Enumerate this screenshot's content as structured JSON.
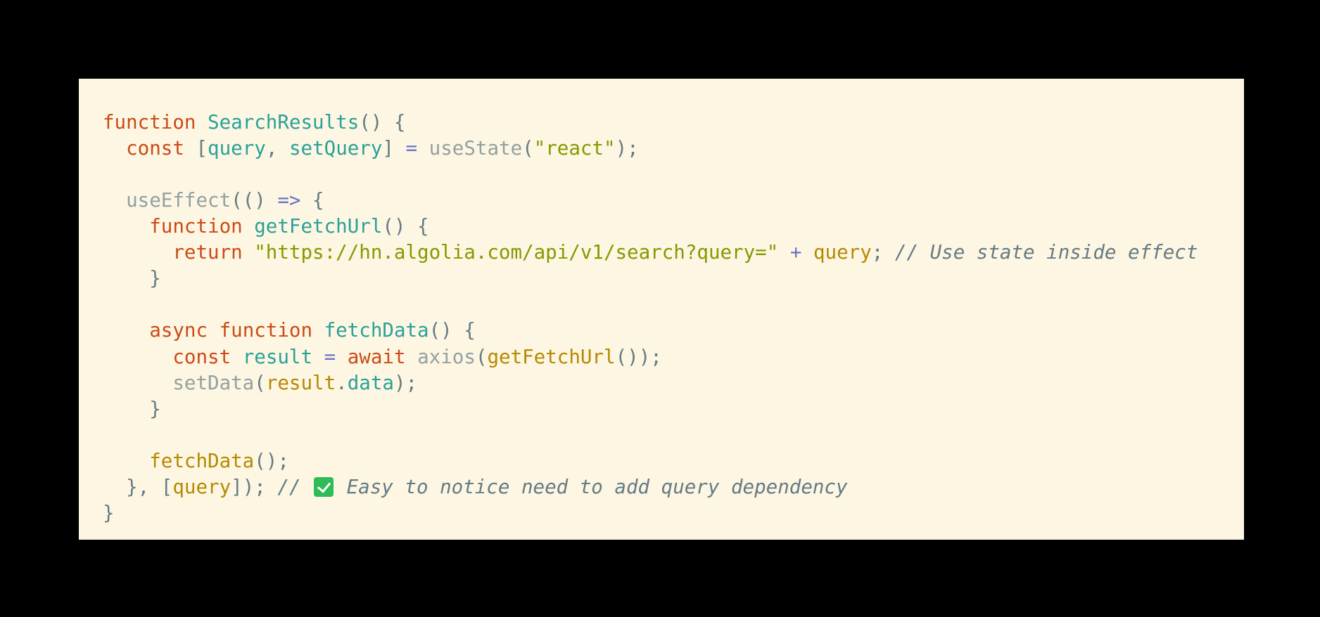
{
  "colors": {
    "background": "#000000",
    "panel": "#fdf6e3",
    "keyword": "#cb4b16",
    "function_name": "#2aa198",
    "call": "#93a1a1",
    "string": "#859900",
    "operator": "#6c71c4",
    "punctuation": "#657b83",
    "variable": "#b58900",
    "comment": "#657b83",
    "check_icon": "#2ebc57"
  },
  "code": {
    "language": "javascript",
    "lines": [
      [
        {
          "kind": "keyword",
          "text": "function"
        },
        {
          "kind": "plain",
          "text": " "
        },
        {
          "kind": "name",
          "text": "SearchResults"
        },
        {
          "kind": "punct",
          "text": "() {"
        }
      ],
      [
        {
          "kind": "indent",
          "text": "  "
        },
        {
          "kind": "keyword",
          "text": "const"
        },
        {
          "kind": "plain",
          "text": " "
        },
        {
          "kind": "punct",
          "text": "["
        },
        {
          "kind": "name",
          "text": "query"
        },
        {
          "kind": "punct",
          "text": ", "
        },
        {
          "kind": "name",
          "text": "setQuery"
        },
        {
          "kind": "punct",
          "text": "] "
        },
        {
          "kind": "operator",
          "text": "="
        },
        {
          "kind": "plain",
          "text": " "
        },
        {
          "kind": "call",
          "text": "useState"
        },
        {
          "kind": "punct",
          "text": "("
        },
        {
          "kind": "string",
          "text": "\"react\""
        },
        {
          "kind": "punct",
          "text": ");"
        }
      ],
      [],
      [
        {
          "kind": "indent",
          "text": "  "
        },
        {
          "kind": "call",
          "text": "useEffect"
        },
        {
          "kind": "punct",
          "text": "(() "
        },
        {
          "kind": "operator",
          "text": "=>"
        },
        {
          "kind": "punct",
          "text": " {"
        }
      ],
      [
        {
          "kind": "indent",
          "text": "    "
        },
        {
          "kind": "keyword",
          "text": "function"
        },
        {
          "kind": "plain",
          "text": " "
        },
        {
          "kind": "name",
          "text": "getFetchUrl"
        },
        {
          "kind": "punct",
          "text": "() {"
        }
      ],
      [
        {
          "kind": "indent",
          "text": "      "
        },
        {
          "kind": "keyword",
          "text": "return"
        },
        {
          "kind": "plain",
          "text": " "
        },
        {
          "kind": "string",
          "text": "\"https://hn.algolia.com/api/v1/search?query=\""
        },
        {
          "kind": "plain",
          "text": " "
        },
        {
          "kind": "operator",
          "text": "+"
        },
        {
          "kind": "plain",
          "text": " "
        },
        {
          "kind": "var",
          "text": "query"
        },
        {
          "kind": "punct",
          "text": "; "
        },
        {
          "kind": "comment",
          "text": "// Use state inside effect"
        }
      ],
      [
        {
          "kind": "indent",
          "text": "    "
        },
        {
          "kind": "punct",
          "text": "}"
        }
      ],
      [],
      [
        {
          "kind": "indent",
          "text": "    "
        },
        {
          "kind": "keyword",
          "text": "async"
        },
        {
          "kind": "plain",
          "text": " "
        },
        {
          "kind": "keyword",
          "text": "function"
        },
        {
          "kind": "plain",
          "text": " "
        },
        {
          "kind": "name",
          "text": "fetchData"
        },
        {
          "kind": "punct",
          "text": "() {"
        }
      ],
      [
        {
          "kind": "indent",
          "text": "      "
        },
        {
          "kind": "keyword",
          "text": "const"
        },
        {
          "kind": "plain",
          "text": " "
        },
        {
          "kind": "name",
          "text": "result"
        },
        {
          "kind": "plain",
          "text": " "
        },
        {
          "kind": "operator",
          "text": "="
        },
        {
          "kind": "plain",
          "text": " "
        },
        {
          "kind": "keyword",
          "text": "await"
        },
        {
          "kind": "plain",
          "text": " "
        },
        {
          "kind": "call",
          "text": "axios"
        },
        {
          "kind": "punct",
          "text": "("
        },
        {
          "kind": "var",
          "text": "getFetchUrl"
        },
        {
          "kind": "punct",
          "text": "());"
        }
      ],
      [
        {
          "kind": "indent",
          "text": "      "
        },
        {
          "kind": "call",
          "text": "setData"
        },
        {
          "kind": "punct",
          "text": "("
        },
        {
          "kind": "var",
          "text": "result"
        },
        {
          "kind": "punct",
          "text": "."
        },
        {
          "kind": "name",
          "text": "data"
        },
        {
          "kind": "punct",
          "text": ");"
        }
      ],
      [
        {
          "kind": "indent",
          "text": "    "
        },
        {
          "kind": "punct",
          "text": "}"
        }
      ],
      [],
      [
        {
          "kind": "indent",
          "text": "    "
        },
        {
          "kind": "var",
          "text": "fetchData"
        },
        {
          "kind": "punct",
          "text": "();"
        }
      ],
      [
        {
          "kind": "indent",
          "text": "  "
        },
        {
          "kind": "punct",
          "text": "}, ["
        },
        {
          "kind": "var",
          "text": "query"
        },
        {
          "kind": "punct",
          "text": "]); "
        },
        {
          "kind": "comment",
          "text": "// "
        },
        {
          "kind": "icon",
          "icon": "check-mark-icon"
        },
        {
          "kind": "comment",
          "text": " Easy to notice need to add query dependency"
        }
      ],
      [
        {
          "kind": "punct",
          "text": "}"
        }
      ]
    ]
  }
}
